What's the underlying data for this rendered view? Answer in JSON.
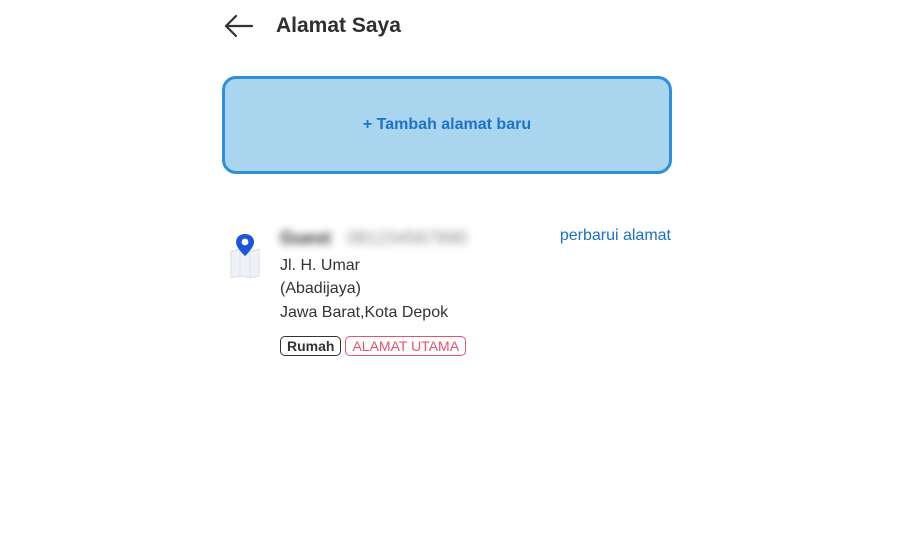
{
  "header": {
    "back_icon": "arrow-left-icon",
    "title": "Alamat Saya"
  },
  "add_address": {
    "label": "+ Tambah alamat baru"
  },
  "address": {
    "icon": "map-pin-icon",
    "name": "Guest",
    "phone": "081234567890",
    "update_label": "perbarui alamat",
    "line1": "Jl. H. Umar",
    "line2": "(Abadijaya)",
    "line3": "Jawa Barat,Kota Depok",
    "tags": {
      "home": "Rumah",
      "main": "ALAMAT UTAMA"
    }
  },
  "colors": {
    "accent": "#2f8fd8",
    "button_bg": "#aad5ef",
    "link": "#1e6fc2",
    "main_tag": "#e0566a"
  }
}
